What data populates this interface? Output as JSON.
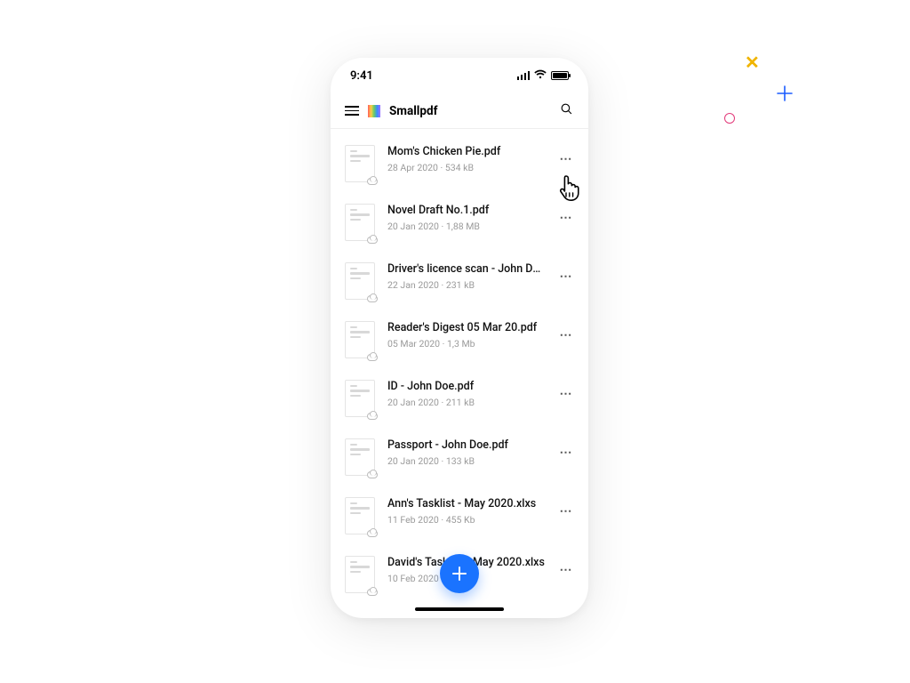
{
  "statusbar": {
    "time": "9:41"
  },
  "appbar": {
    "brand": "Smallpdf"
  },
  "files": [
    {
      "name": "Mom's Chicken Pie.pdf",
      "meta": "28 Apr 2020 · 534 kB"
    },
    {
      "name": "Novel Draft No.1.pdf",
      "meta": "20 Jan 2020 · 1,88 MB"
    },
    {
      "name": "Driver's licence scan - John Doe.jpg",
      "meta": "22 Jan 2020 · 231 kB"
    },
    {
      "name": "Reader's Digest 05 Mar 20.pdf",
      "meta": "05 Mar 2020 · 1,3 Mb"
    },
    {
      "name": "ID - John Doe.pdf",
      "meta": "20 Jan 2020 · 211 kB"
    },
    {
      "name": "Passport - John Doe.pdf",
      "meta": "20 Jan 2020 · 133 kB"
    },
    {
      "name": "Ann's Tasklist - May 2020.xlxs",
      "meta": "11 Feb 2020 · 455 Kb"
    },
    {
      "name": "David's Tasklist - May 2020.xlxs",
      "meta": "10 Feb 2020 · 345 kB"
    }
  ],
  "more_label": "⋯"
}
